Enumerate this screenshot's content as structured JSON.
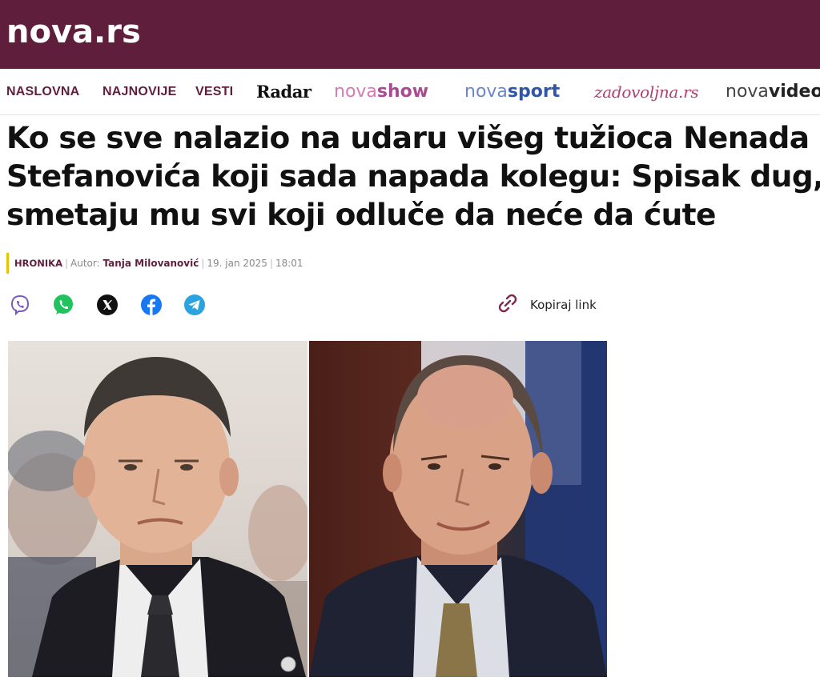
{
  "site": {
    "logo": "nova.rs"
  },
  "nav": {
    "items": [
      {
        "label": "NASLOVNA"
      },
      {
        "label": "NAJNOVIJE"
      },
      {
        "label": "VESTI"
      },
      {
        "label": "Radar"
      }
    ],
    "brands": {
      "novashow": {
        "a": "nova",
        "b": "show",
        "color_a": "#d77ab7",
        "color_b": "#a94a92"
      },
      "novasport": {
        "a": "nova",
        "b": "sport",
        "color_a": "#4d6fb4",
        "color_b": "#2f56a8"
      },
      "zadovoljna": {
        "label": "zadovoljna.rs"
      },
      "novavideo": {
        "a": "nova",
        "b": "video",
        "color_a": "#333333",
        "color_b": "#111111"
      }
    }
  },
  "article": {
    "headline_lines": [
      "Ko se sve nalazio na udaru višeg tužioca Nenada",
      "Stefanovića koji sada napada kolegu: Spisak dug,",
      "smetaju mu svi koji odluče da neće da ćute"
    ],
    "category": "HRONIKA",
    "author_prefix": "Autor:",
    "author": "Tanja Milovanović",
    "date": "19. jan 2025",
    "time": "18:01"
  },
  "share": {
    "icons": [
      "viber-icon",
      "whatsapp-icon",
      "x-icon",
      "facebook-icon",
      "telegram-icon"
    ],
    "copy_label": "Kopiraj link"
  },
  "colors": {
    "brand": "#5f1f3c",
    "accent_yellow": "#e8c400"
  }
}
